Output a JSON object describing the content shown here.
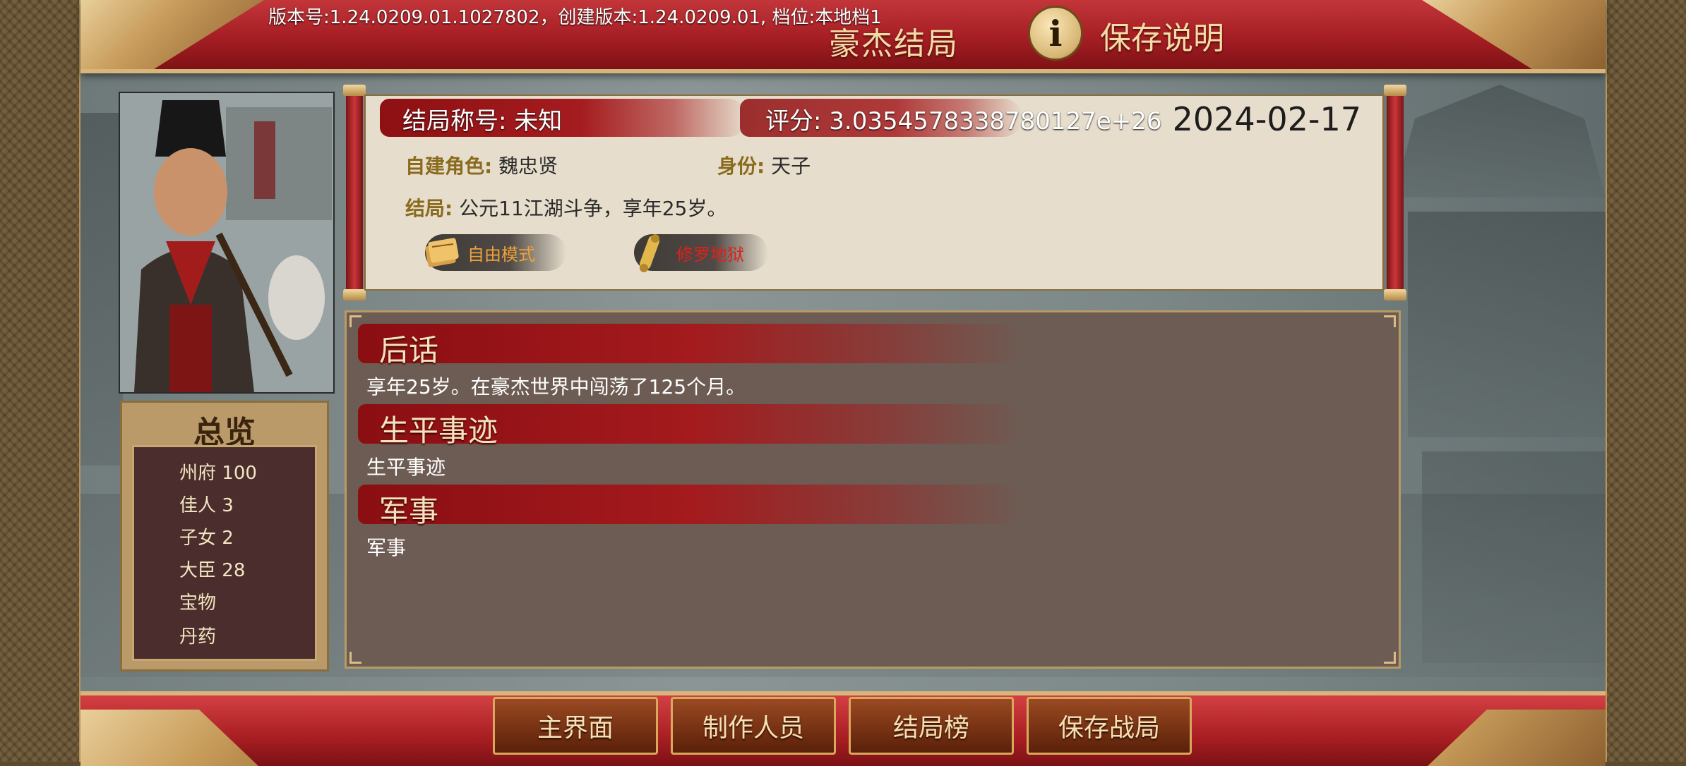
{
  "header": {
    "version": "版本号:1.24.0209.01.1027802，创建版本:1.24.0209.01, 档位:本地档1",
    "title": "豪杰结局",
    "info_icon": "i",
    "save_desc_label": "保存说明"
  },
  "overview": {
    "title": "总览",
    "items": [
      {
        "label": "州府",
        "value": "100"
      },
      {
        "label": "佳人",
        "value": "3"
      },
      {
        "label": "子女",
        "value": "2"
      },
      {
        "label": "大臣",
        "value": "28"
      },
      {
        "label": "宝物",
        "value": ""
      },
      {
        "label": "丹药",
        "value": ""
      }
    ]
  },
  "ending": {
    "title_label": "结局称号:",
    "title_value": "未知",
    "score_label": "评分:",
    "score_value": "3.0354578338780127e+26",
    "date": "2024-02-17",
    "role_label": "自建角色:",
    "role_value": "魏忠贤",
    "identity_label": "身份:",
    "identity_value": "天子",
    "result_label": "结局:",
    "result_value": "公元11江湖斗争，享年25岁。",
    "mode_tag": "自由模式",
    "difficulty_tag": "修罗地狱"
  },
  "sections": [
    {
      "title": "后话",
      "body": "享年25岁。在豪杰世界中闯荡了125个月。"
    },
    {
      "title": "生平事迹",
      "body": "生平事迹"
    },
    {
      "title": "军事",
      "body": "军事"
    }
  ],
  "bottom_buttons": [
    "主界面",
    "制作人员",
    "结局榜",
    "保存战局"
  ],
  "colors": {
    "banner_red": "#a51e23",
    "gold": "#d8b57a",
    "panel_brown": "#6d5c53",
    "tag_mode_text": "#f0a23a",
    "tag_difficulty_text": "#e0201d"
  }
}
